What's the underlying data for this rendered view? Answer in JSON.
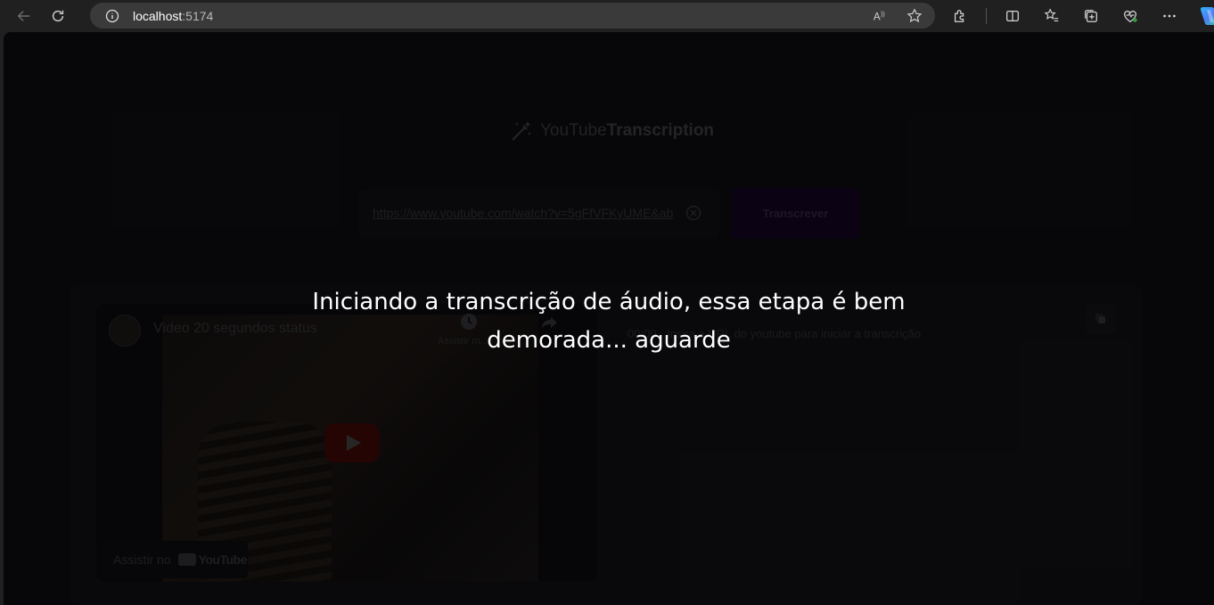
{
  "browser": {
    "url_host": "localhost",
    "url_port": ":5174"
  },
  "app": {
    "brand_light": "YouTube",
    "brand_bold": "Transcription",
    "url_value": "https://www.youtube.com/watch?v=5gFfVFKyUME&ab",
    "transcribe_label": "Transcrever",
    "video": {
      "title": "Video 20 segundos status",
      "watch_later_label": "Assistir m...",
      "watch_on_label": "Assistir no",
      "platform_label": "YouTube"
    },
    "transcript": {
      "time": "00:00",
      "text": "Insira a URL  do youtube para  iniciar a transcrição"
    }
  },
  "overlay": {
    "message": "Iniciando a transcrição de áudio, essa etapa é bem demorada... aguarde"
  },
  "colors": {
    "accent_purple": "#12041e",
    "youtube_red": "#3a0707"
  }
}
